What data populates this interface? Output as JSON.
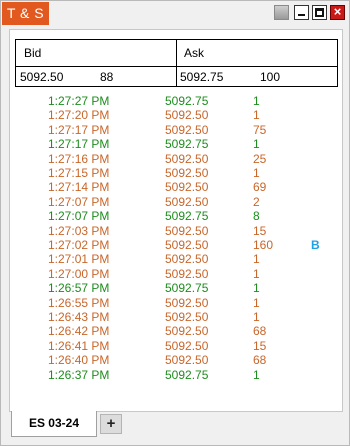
{
  "window": {
    "title": "T & S",
    "title_bg": "#e2591f",
    "close_bg": "#c91a1a"
  },
  "quote": {
    "bid_label": "Bid",
    "ask_label": "Ask",
    "bid_price": "5092.50",
    "bid_size": "88",
    "ask_price": "5092.75",
    "ask_size": "100"
  },
  "colors": {
    "buy": "#1e8c1e",
    "sell": "#c8662a",
    "flag": "#1ea2e6"
  },
  "trades": [
    {
      "time": "1:27:27 PM",
      "price": "5092.75",
      "size": "1",
      "side": "buy",
      "flag": ""
    },
    {
      "time": "1:27:20 PM",
      "price": "5092.50",
      "size": "1",
      "side": "sell",
      "flag": ""
    },
    {
      "time": "1:27:17 PM",
      "price": "5092.50",
      "size": "75",
      "side": "sell",
      "flag": ""
    },
    {
      "time": "1:27:17 PM",
      "price": "5092.75",
      "size": "1",
      "side": "buy",
      "flag": ""
    },
    {
      "time": "1:27:16 PM",
      "price": "5092.50",
      "size": "25",
      "side": "sell",
      "flag": ""
    },
    {
      "time": "1:27:15 PM",
      "price": "5092.50",
      "size": "1",
      "side": "sell",
      "flag": ""
    },
    {
      "time": "1:27:14 PM",
      "price": "5092.50",
      "size": "69",
      "side": "sell",
      "flag": ""
    },
    {
      "time": "1:27:07 PM",
      "price": "5092.50",
      "size": "2",
      "side": "sell",
      "flag": ""
    },
    {
      "time": "1:27:07 PM",
      "price": "5092.75",
      "size": "8",
      "side": "buy",
      "flag": ""
    },
    {
      "time": "1:27:03 PM",
      "price": "5092.50",
      "size": "15",
      "side": "sell",
      "flag": ""
    },
    {
      "time": "1:27:02 PM",
      "price": "5092.50",
      "size": "160",
      "side": "sell",
      "flag": "B"
    },
    {
      "time": "1:27:01 PM",
      "price": "5092.50",
      "size": "1",
      "side": "sell",
      "flag": ""
    },
    {
      "time": "1:27:00 PM",
      "price": "5092.50",
      "size": "1",
      "side": "sell",
      "flag": ""
    },
    {
      "time": "1:26:57 PM",
      "price": "5092.75",
      "size": "1",
      "side": "buy",
      "flag": ""
    },
    {
      "time": "1:26:55 PM",
      "price": "5092.50",
      "size": "1",
      "side": "sell",
      "flag": ""
    },
    {
      "time": "1:26:43 PM",
      "price": "5092.50",
      "size": "1",
      "side": "sell",
      "flag": ""
    },
    {
      "time": "1:26:42 PM",
      "price": "5092.50",
      "size": "68",
      "side": "sell",
      "flag": ""
    },
    {
      "time": "1:26:41 PM",
      "price": "5092.50",
      "size": "15",
      "side": "sell",
      "flag": ""
    },
    {
      "time": "1:26:40 PM",
      "price": "5092.50",
      "size": "68",
      "side": "sell",
      "flag": ""
    },
    {
      "time": "1:26:37 PM",
      "price": "5092.75",
      "size": "1",
      "side": "buy",
      "flag": ""
    }
  ],
  "tabs": [
    {
      "label": "ES 03-24"
    }
  ],
  "add_tab_label": "+"
}
